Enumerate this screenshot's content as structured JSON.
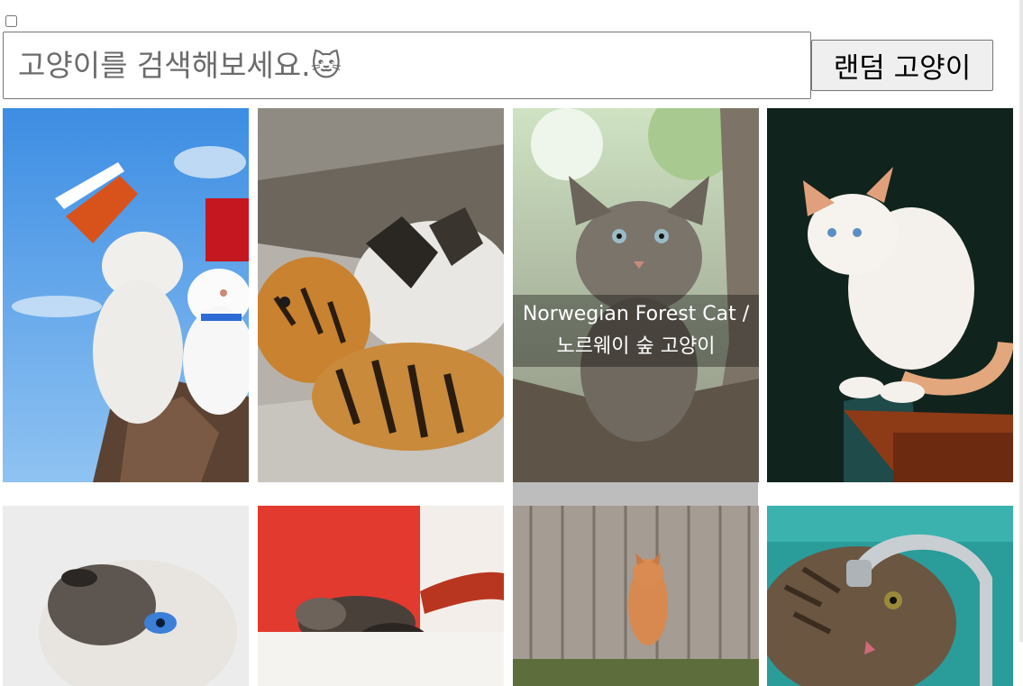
{
  "search": {
    "placeholder": "고양이를 검색해보세요.🐱",
    "value": ""
  },
  "random_button_label": "랜덤 고양이",
  "cards": [
    {
      "icon": "cat-photo-noodle-cup-cats",
      "label": ""
    },
    {
      "icon": "tiger-cubs-photo",
      "label": ""
    },
    {
      "icon": "kitten-on-branch-photo",
      "label": "Norwegian Forest Cat / 노르웨이 숲 고양이"
    },
    {
      "icon": "white-cat-on-table-photo",
      "label": ""
    },
    {
      "icon": "siamese-cat-photo",
      "label": ""
    },
    {
      "icon": "tabby-kitten-sleeping-photo",
      "label": ""
    },
    {
      "icon": "orange-cat-at-fence-photo",
      "label": ""
    },
    {
      "icon": "cat-drinking-faucet-photo",
      "label": ""
    }
  ]
}
